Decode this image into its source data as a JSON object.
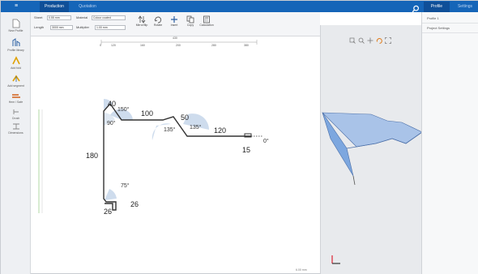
{
  "topbar": {
    "menu_glyph": "≡",
    "tabs": [
      "Production",
      "Quotation"
    ],
    "right_tabs": [
      "Profile",
      "Settings"
    ],
    "search_icon": "search-icon"
  },
  "tools": [
    {
      "label": "New Profile",
      "icon": "new-document-icon"
    },
    {
      "label": "Profile library",
      "icon": "library-icon"
    },
    {
      "label": "Add fold",
      "icon": "fold-icon"
    },
    {
      "label": "Add segment",
      "icon": "segment-icon"
    },
    {
      "label": "Hem / Safe",
      "icon": "hem-icon"
    },
    {
      "label": "Crush",
      "icon": "crush-icon"
    },
    {
      "label": "Dimensions",
      "icon": "dimension-icon"
    }
  ],
  "ribbon": {
    "fields": [
      {
        "label": "Sheet",
        "value": "0.55 mm"
      },
      {
        "label": "Material",
        "value": "Colour coated"
      },
      {
        "label": "Length",
        "value": "3000 mm"
      },
      {
        "label": "Multiplier",
        "value": "1.00 mm"
      }
    ],
    "buttons": [
      {
        "label": "Mirror/flip",
        "icon": "flip-icon"
      },
      {
        "label": "Rotate",
        "icon": "rotate-icon"
      },
      {
        "label": "Insert",
        "icon": "move-icon"
      },
      {
        "label": "Copy",
        "icon": "copy-icon"
      },
      {
        "label": "Calculation",
        "icon": "calculator-icon"
      }
    ]
  },
  "ruler": {
    "title": "430",
    "ticks": [
      "0",
      "120",
      "160",
      "200",
      "280",
      "380",
      "430"
    ]
  },
  "drawing": {
    "dimensions": [
      "40",
      "100",
      "50",
      "120",
      "180",
      "15",
      "26",
      "26",
      "0°"
    ],
    "angles": [
      "150°",
      "90°",
      "135°",
      "135°",
      "75°"
    ]
  },
  "status": "6.00 mm",
  "panel": {
    "rows": [
      "Profile 1",
      "Project Settings"
    ]
  },
  "colors": {
    "accent": "#1565b8",
    "profile_fill": "#7da7df",
    "angle_fill": "#b9cde6"
  }
}
